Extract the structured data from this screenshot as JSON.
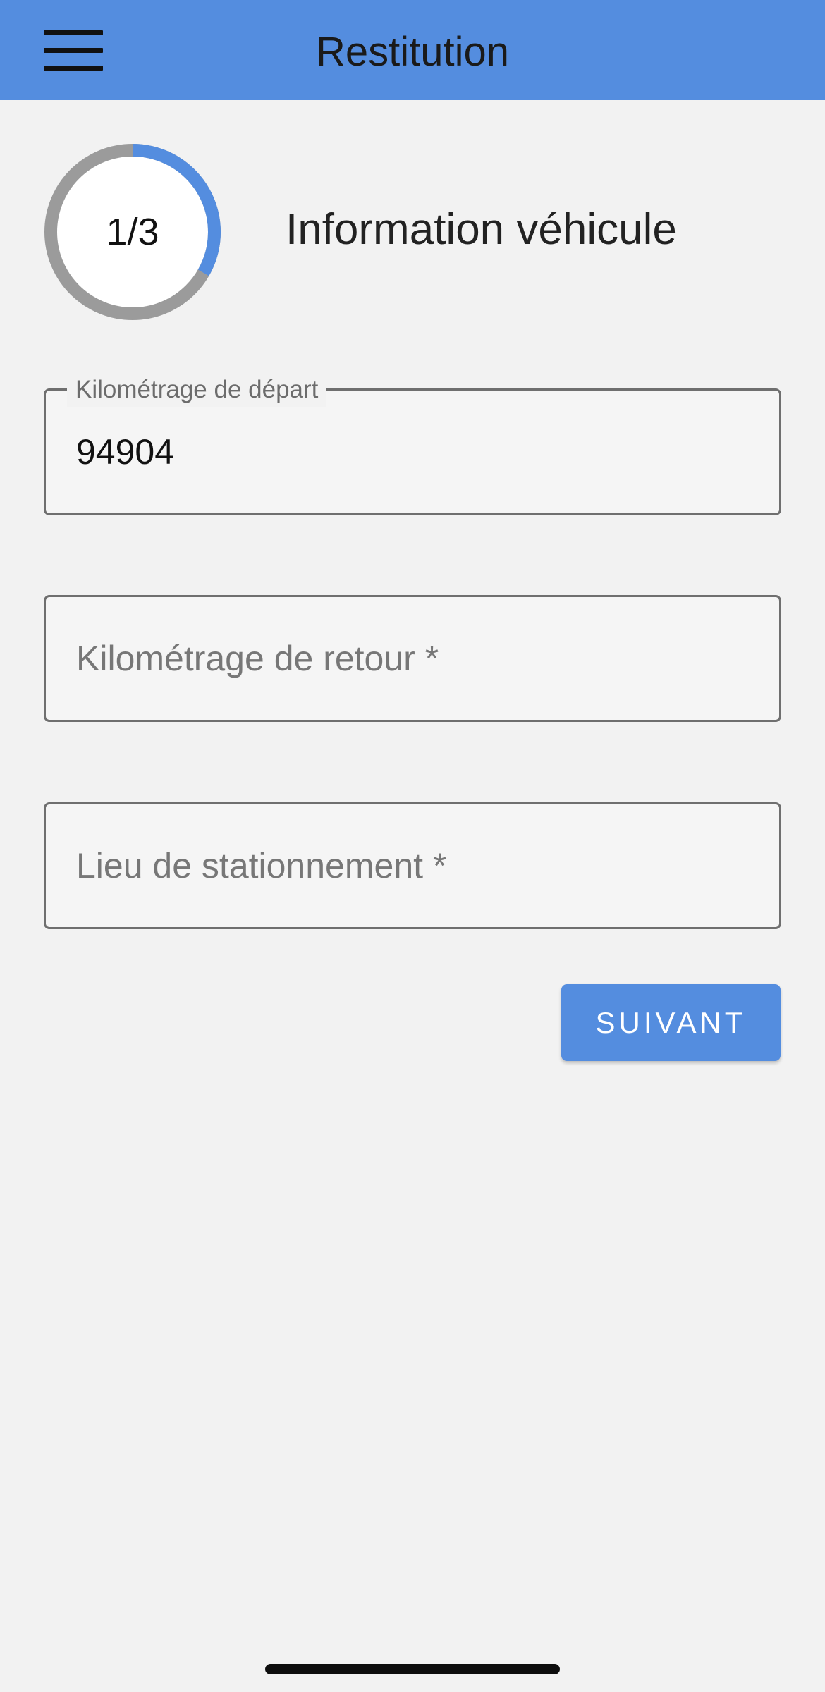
{
  "app_bar": {
    "title": "Restitution",
    "menu_icon": "hamburger-menu-icon",
    "color": "#548ddf"
  },
  "stepper": {
    "current_step": 1,
    "total_steps": 3,
    "label": "1/3",
    "progress": 0.333,
    "progress_color": "#548ddf",
    "track_color": "#9b9b9b",
    "title": "Information véhicule"
  },
  "form": {
    "departure_mileage": {
      "label": "Kilométrage de départ",
      "value": "94904"
    },
    "return_mileage": {
      "placeholder": "Kilométrage de retour *",
      "value": ""
    },
    "parking_location": {
      "placeholder": "Lieu de stationnement *",
      "value": ""
    },
    "next_label": "SUIVANT"
  }
}
